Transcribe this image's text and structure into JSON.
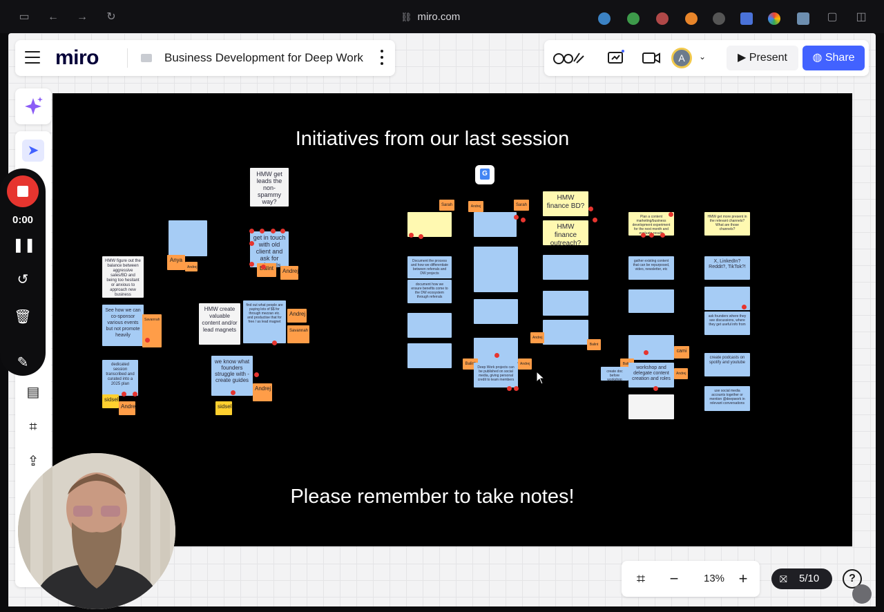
{
  "browser": {
    "url": "miro.com"
  },
  "topbar": {
    "logo": "miro",
    "board_title": "Business Development for Deep Work",
    "avatar_initial": "A",
    "present_label": "Present",
    "share_label": "Share"
  },
  "recorder": {
    "time": "0:00"
  },
  "frame": {
    "title": "Initiatives from our last session",
    "footer": "Please remember to take notes!"
  },
  "notes": {
    "hmw_spammy": "HMW get leads the non-spammy way?",
    "touch_old_client": "get in touch with old client and ask for referrals",
    "hmw_balance": "HMW figure out the balance between aggressive sales/BD and being too hesitant or anxious to approach new business",
    "co_sponsor": "See how we can co-sponsor various events but not promote heavily",
    "dedicated_session": "dedicated session transcribed and curated into a 2025 plan",
    "hmw_content": "HMW create valuable content and/or lead magnets",
    "find_people": "find out what people are paying lots of $$ for through mezzan etc. and productise that for free / as lead magnet",
    "founders_struggle": "we know what founders struggle with - create guides",
    "document_process": "Document the process and how we differentiate between referrals and DW projects",
    "document_benefits": "document how we ensure benefits come to the DW ecosystem through referrals",
    "hmw_finance_bd": "HMW finance BD?",
    "hmw_finance_outreach": "HMW finance outreach?",
    "deep_work_projects": "Deep Work projects can be published on social media, giving personal credit to team members",
    "workshop_delegate": "workshop and delegate content creation and roles",
    "create_doc": "create doc before workshop",
    "gather_content": "gather existing content that can be repurposed, video, newsletter, etc",
    "x_linkedin": "X, LinkedIn? Reddit?, TikTok?!",
    "ask_founders": "ask founders where they see discussions, where they get useful info from",
    "podcasts": "create podcasts on spotify and youtube",
    "social_media": "use social media accounts together or mention @deepwork in relevant conversations",
    "hmw_present": "HMW get more present in the relevant channels? What are those channels?",
    "plan_content": "Plan a content marketing/business development experiment for the next month and evaluate results"
  },
  "tags": {
    "anya": "Anya",
    "andrej": "Andrej",
    "balint": "Balint",
    "sidsel": "sidsel",
    "savannah": "Savannah",
    "sarah": "Sarah",
    "cami": "cami"
  },
  "zoom": {
    "value": "13%"
  },
  "pages": {
    "value": "5/10"
  },
  "help_label": "?",
  "colors": {
    "accent": "#4262ff",
    "record": "#e6352f",
    "sticky_blue": "#a6ccf5",
    "sticky_yellow": "#fff9b1",
    "sticky_orange": "#ff9d48"
  }
}
